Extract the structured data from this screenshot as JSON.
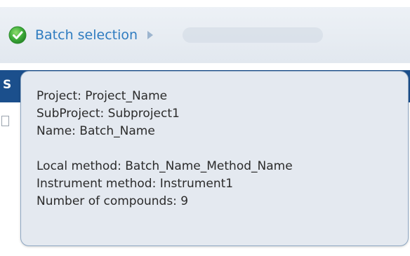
{
  "step_bar": {
    "step_label": "Batch selection",
    "step_status_icon": "check-circle-icon",
    "step_arrow_icon": "chevron-right-icon",
    "accent_color": "#2f7cc0",
    "success_color": "#3fae3a"
  },
  "background_strip": {
    "partial_letter": "S"
  },
  "tooltip": {
    "project": "Project:  Project_Name",
    "subproject": "SubProject: Subproject1",
    "name": "Name: Batch_Name",
    "local_method": "Local method: Batch_Name_Method_Name",
    "instrument_method": "Instrument method: Instrument1",
    "compounds": "Number of compounds: 9"
  }
}
